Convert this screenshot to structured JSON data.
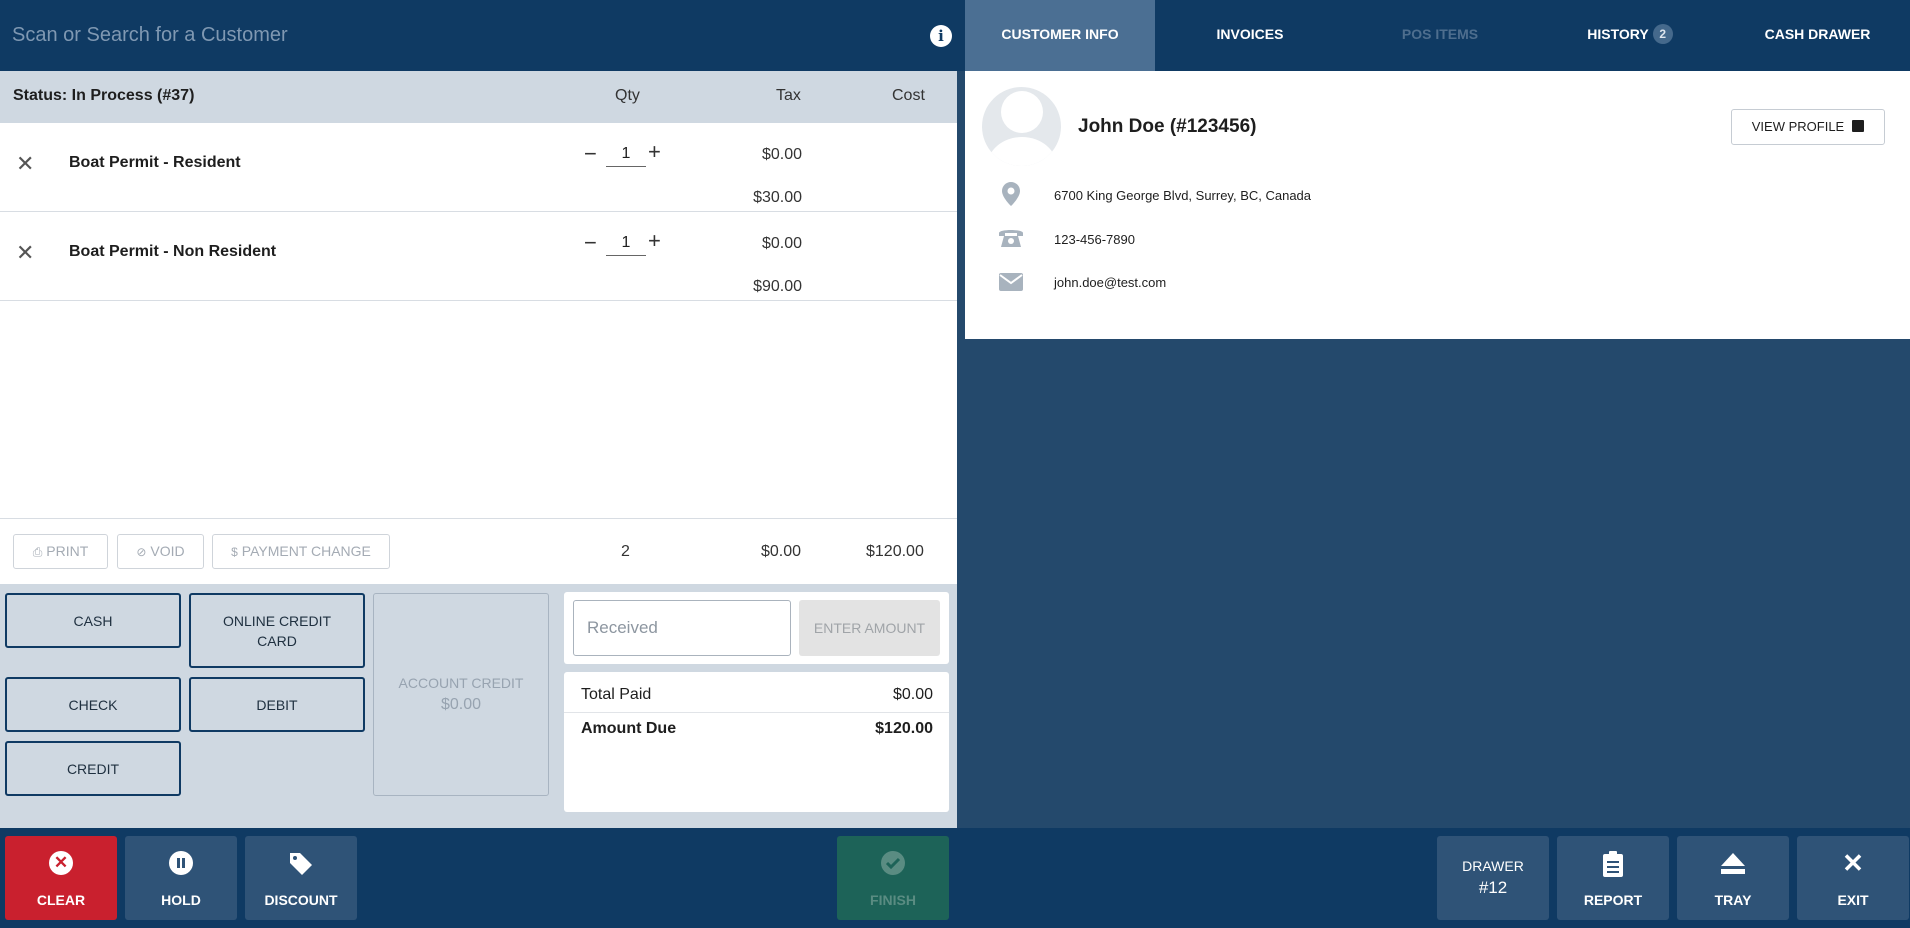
{
  "search": {
    "placeholder": "Scan or Search for a Customer"
  },
  "tabs": [
    {
      "label": "CUSTOMER INFO"
    },
    {
      "label": "INVOICES"
    },
    {
      "label": "POS ITEMS"
    },
    {
      "label": "HISTORY",
      "badge": "2"
    },
    {
      "label": "CASH DRAWER"
    }
  ],
  "order": {
    "status": "Status: In Process (#37)",
    "headers": {
      "qty": "Qty",
      "tax": "Tax",
      "cost": "Cost"
    },
    "items": [
      {
        "name": "Boat Permit - Resident",
        "qty": "1",
        "tax": "$0.00",
        "cost": "$30.00"
      },
      {
        "name": "Boat Permit - Non Resident",
        "qty": "1",
        "tax": "$0.00",
        "cost": "$90.00"
      }
    ],
    "totals": {
      "qty": "2",
      "tax": "$0.00",
      "cost": "$120.00"
    }
  },
  "actions": {
    "print": "PRINT",
    "void": "VOID",
    "payment_change": "PAYMENT CHANGE"
  },
  "payment": {
    "cash": "CASH",
    "online_credit_card": "ONLINE CREDIT CARD",
    "check": "CHECK",
    "debit": "DEBIT",
    "credit": "CREDIT",
    "account_credit_label": "ACCOUNT CREDIT",
    "account_credit_value": "$0.00",
    "received_placeholder": "Received",
    "enter_amount": "ENTER AMOUNT",
    "total_paid_label": "Total Paid",
    "total_paid_value": "$0.00",
    "amount_due_label": "Amount Due",
    "amount_due_value": "$120.00"
  },
  "customer": {
    "name": "John Doe (#123456)",
    "view_profile": "VIEW PROFILE",
    "address": "6700 King George Blvd, Surrey, BC, Canada",
    "phone": "123-456-7890",
    "email": "john.doe@test.com"
  },
  "bottom": {
    "clear": "CLEAR",
    "hold": "HOLD",
    "discount": "DISCOUNT",
    "finish": "FINISH",
    "drawer_label": "DRAWER",
    "drawer_number": "#12",
    "report": "REPORT",
    "tray": "TRAY",
    "exit": "EXIT"
  },
  "colors": {
    "navy": "#0f3a63",
    "panel": "#cfd8e1",
    "clear_red": "#c9202e",
    "finish_green": "#1d6358",
    "active_tab": "#4b6f93"
  }
}
